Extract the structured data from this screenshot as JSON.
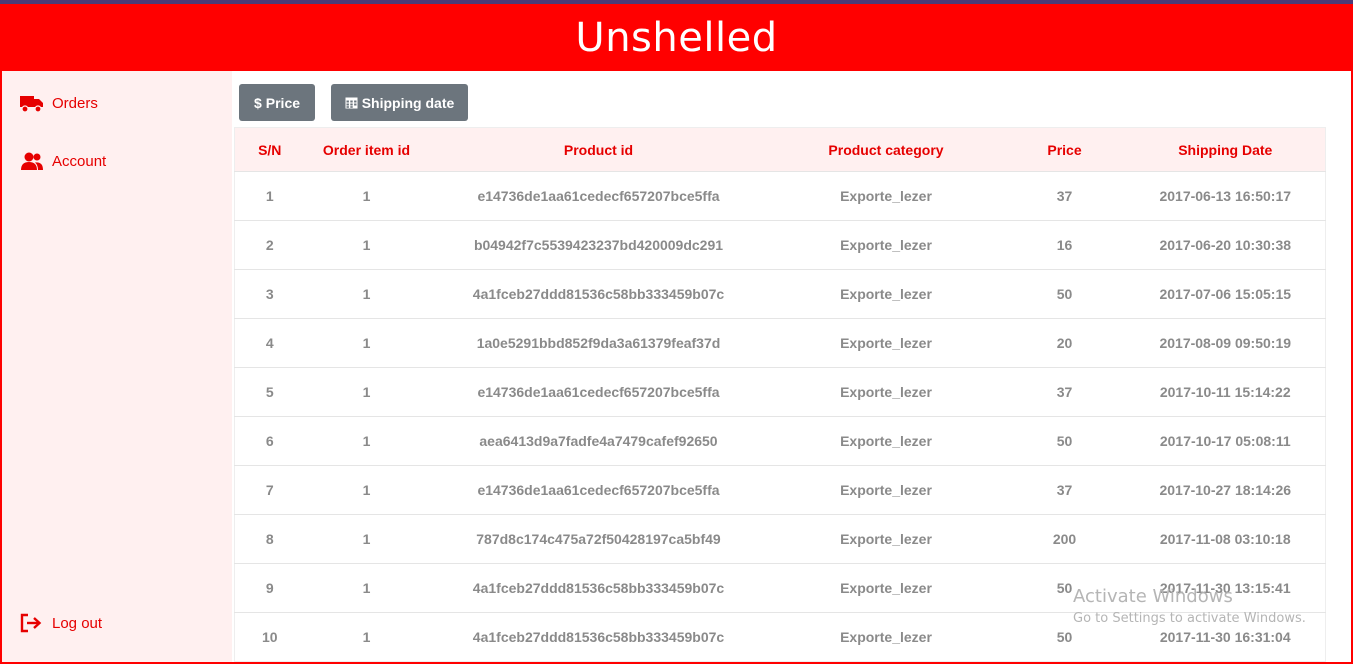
{
  "app": {
    "title": "Unshelled"
  },
  "sidebar": {
    "items": [
      {
        "label": "Orders",
        "icon": "truck-icon"
      },
      {
        "label": "Account",
        "icon": "users-icon"
      }
    ],
    "logout": {
      "label": "Log out",
      "icon": "sign-out-icon"
    }
  },
  "toolbar": {
    "price_label": "Price",
    "shipping_label": "Shipping date"
  },
  "table": {
    "headers": [
      "S/N",
      "Order item id",
      "Product id",
      "Product category",
      "Price",
      "Shipping Date"
    ],
    "rows": [
      [
        "1",
        "1",
        "e14736de1aa61cedecf657207bce5ffa",
        "Exporte_lezer",
        "37",
        "2017-06-13 16:50:17"
      ],
      [
        "2",
        "1",
        "b04942f7c5539423237bd420009dc291",
        "Exporte_lezer",
        "16",
        "2017-06-20 10:30:38"
      ],
      [
        "3",
        "1",
        "4a1fceb27ddd81536c58bb333459b07c",
        "Exporte_lezer",
        "50",
        "2017-07-06 15:05:15"
      ],
      [
        "4",
        "1",
        "1a0e5291bbd852f9da3a61379feaf37d",
        "Exporte_lezer",
        "20",
        "2017-08-09 09:50:19"
      ],
      [
        "5",
        "1",
        "e14736de1aa61cedecf657207bce5ffa",
        "Exporte_lezer",
        "37",
        "2017-10-11 15:14:22"
      ],
      [
        "6",
        "1",
        "aea6413d9a7fadfe4a7479cafef92650",
        "Exporte_lezer",
        "50",
        "2017-10-17 05:08:11"
      ],
      [
        "7",
        "1",
        "e14736de1aa61cedecf657207bce5ffa",
        "Exporte_lezer",
        "37",
        "2017-10-27 18:14:26"
      ],
      [
        "8",
        "1",
        "787d8c174c475a72f50428197ca5bf49",
        "Exporte_lezer",
        "200",
        "2017-11-08 03:10:18"
      ],
      [
        "9",
        "1",
        "4a1fceb27ddd81536c58bb333459b07c",
        "Exporte_lezer",
        "50",
        "2017-11-30 13:15:41"
      ],
      [
        "10",
        "1",
        "4a1fceb27ddd81536c58bb333459b07c",
        "Exporte_lezer",
        "50",
        "2017-11-30 16:31:04"
      ]
    ]
  },
  "watermark": {
    "line1": "Activate Windows",
    "line2": "Go to Settings to activate Windows."
  },
  "colors": {
    "accent": "#ff0000",
    "sidebar_bg": "#fff0f0",
    "button_bg": "#6c757d",
    "cell_text": "#8a8a8a"
  }
}
